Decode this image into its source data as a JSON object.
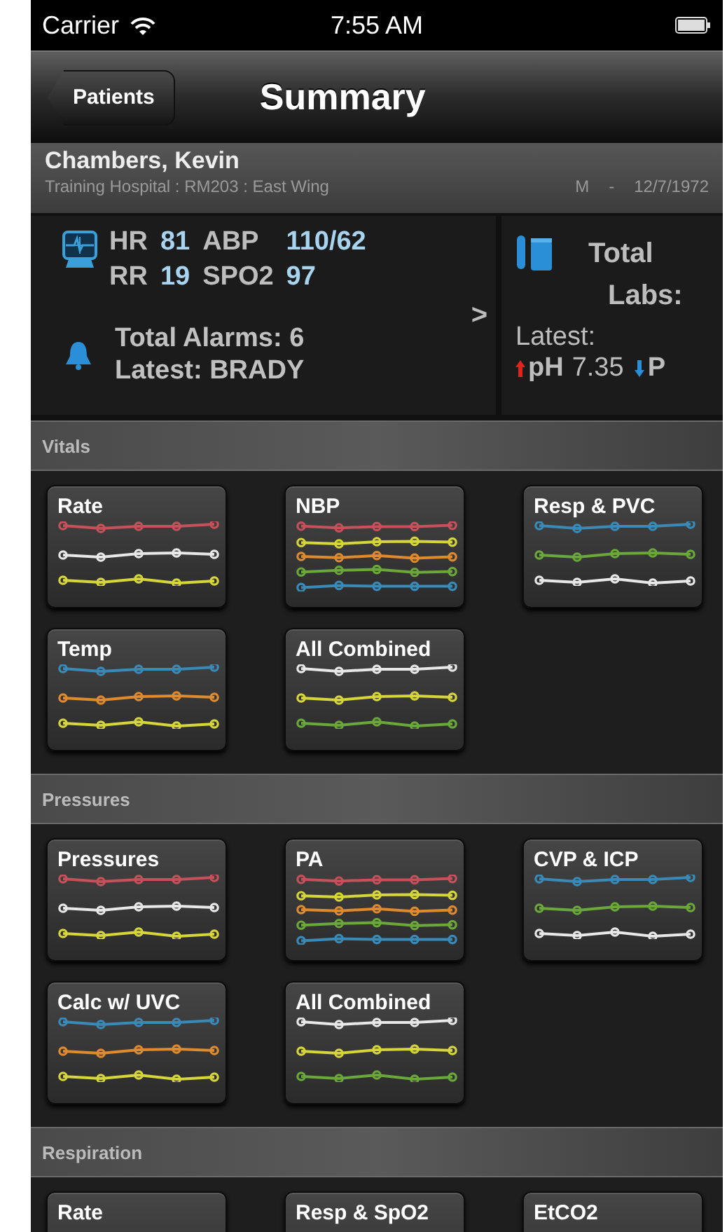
{
  "status_bar": {
    "carrier": "Carrier",
    "time": "7:55 AM"
  },
  "nav_bar": {
    "back": "Patients",
    "title": "Summary"
  },
  "patient": {
    "name": "Chambers, Kevin",
    "location": "Training Hospital : RM203 : East Wing",
    "sex": "M",
    "separator": "-",
    "dob": "12/7/1972"
  },
  "vitals_card": {
    "readings": [
      {
        "label": "HR",
        "value": "81"
      },
      {
        "label": "ABP",
        "value": "110/62"
      },
      {
        "label": "RR",
        "value": "19"
      },
      {
        "label": "SPO2",
        "value": "97"
      }
    ],
    "alarms": "Total Alarms: 6",
    "latest_alarm": "Latest: BRADY",
    "chevron": ">"
  },
  "labs_card": {
    "total": "Total",
    "labs": "Labs:",
    "latest": "Latest:",
    "results": [
      {
        "kind": "up",
        "name": "pH",
        "value": "7.35"
      },
      {
        "kind": "down",
        "name": "P"
      }
    ]
  },
  "sections": [
    {
      "title": "Vitals",
      "tiles": [
        {
          "title": "Rate",
          "lines": [
            {
              "color": "#c8505a"
            },
            {
              "color": "#e8e8e8"
            },
            {
              "color": "#d6d63a"
            }
          ]
        },
        {
          "title": "NBP",
          "lines": [
            {
              "color": "#c8505a"
            },
            {
              "color": "#d6d63a"
            },
            {
              "color": "#e08a2e"
            },
            {
              "color": "#6aa83a"
            },
            {
              "color": "#3a8ab8"
            }
          ]
        },
        {
          "title": "Resp & PVC",
          "lines": [
            {
              "color": "#3a8ab8"
            },
            {
              "color": "#6aa83a"
            },
            {
              "color": "#e8e8e8"
            }
          ]
        },
        {
          "title": "Temp",
          "lines": [
            {
              "color": "#3a8ab8"
            },
            {
              "color": "#e08a2e"
            },
            {
              "color": "#d6d63a"
            }
          ]
        },
        {
          "title": "All Combined",
          "lines": [
            {
              "color": "#e8e8e8"
            },
            {
              "color": "#d6d63a"
            },
            {
              "color": "#6aa83a"
            }
          ]
        }
      ]
    },
    {
      "title": "Pressures",
      "tiles": [
        {
          "title": "Pressures",
          "lines": [
            {
              "color": "#c8505a"
            },
            {
              "color": "#e8e8e8"
            },
            {
              "color": "#d6d63a"
            }
          ]
        },
        {
          "title": "PA",
          "lines": [
            {
              "color": "#c8505a"
            },
            {
              "color": "#d6d63a"
            },
            {
              "color": "#e08a2e"
            },
            {
              "color": "#6aa83a"
            },
            {
              "color": "#3a8ab8"
            }
          ]
        },
        {
          "title": "CVP & ICP",
          "lines": [
            {
              "color": "#3a8ab8"
            },
            {
              "color": "#6aa83a"
            },
            {
              "color": "#e8e8e8"
            }
          ]
        },
        {
          "title": "Calc w/ UVC",
          "lines": [
            {
              "color": "#3a8ab8"
            },
            {
              "color": "#e08a2e"
            },
            {
              "color": "#d6d63a"
            }
          ]
        },
        {
          "title": "All Combined",
          "lines": [
            {
              "color": "#e8e8e8"
            },
            {
              "color": "#d6d63a"
            },
            {
              "color": "#6aa83a"
            }
          ]
        }
      ]
    },
    {
      "title": "Respiration",
      "tiles": [
        {
          "title": "Rate"
        },
        {
          "title": "Resp & SpO2"
        },
        {
          "title": "EtCO2"
        }
      ]
    }
  ]
}
